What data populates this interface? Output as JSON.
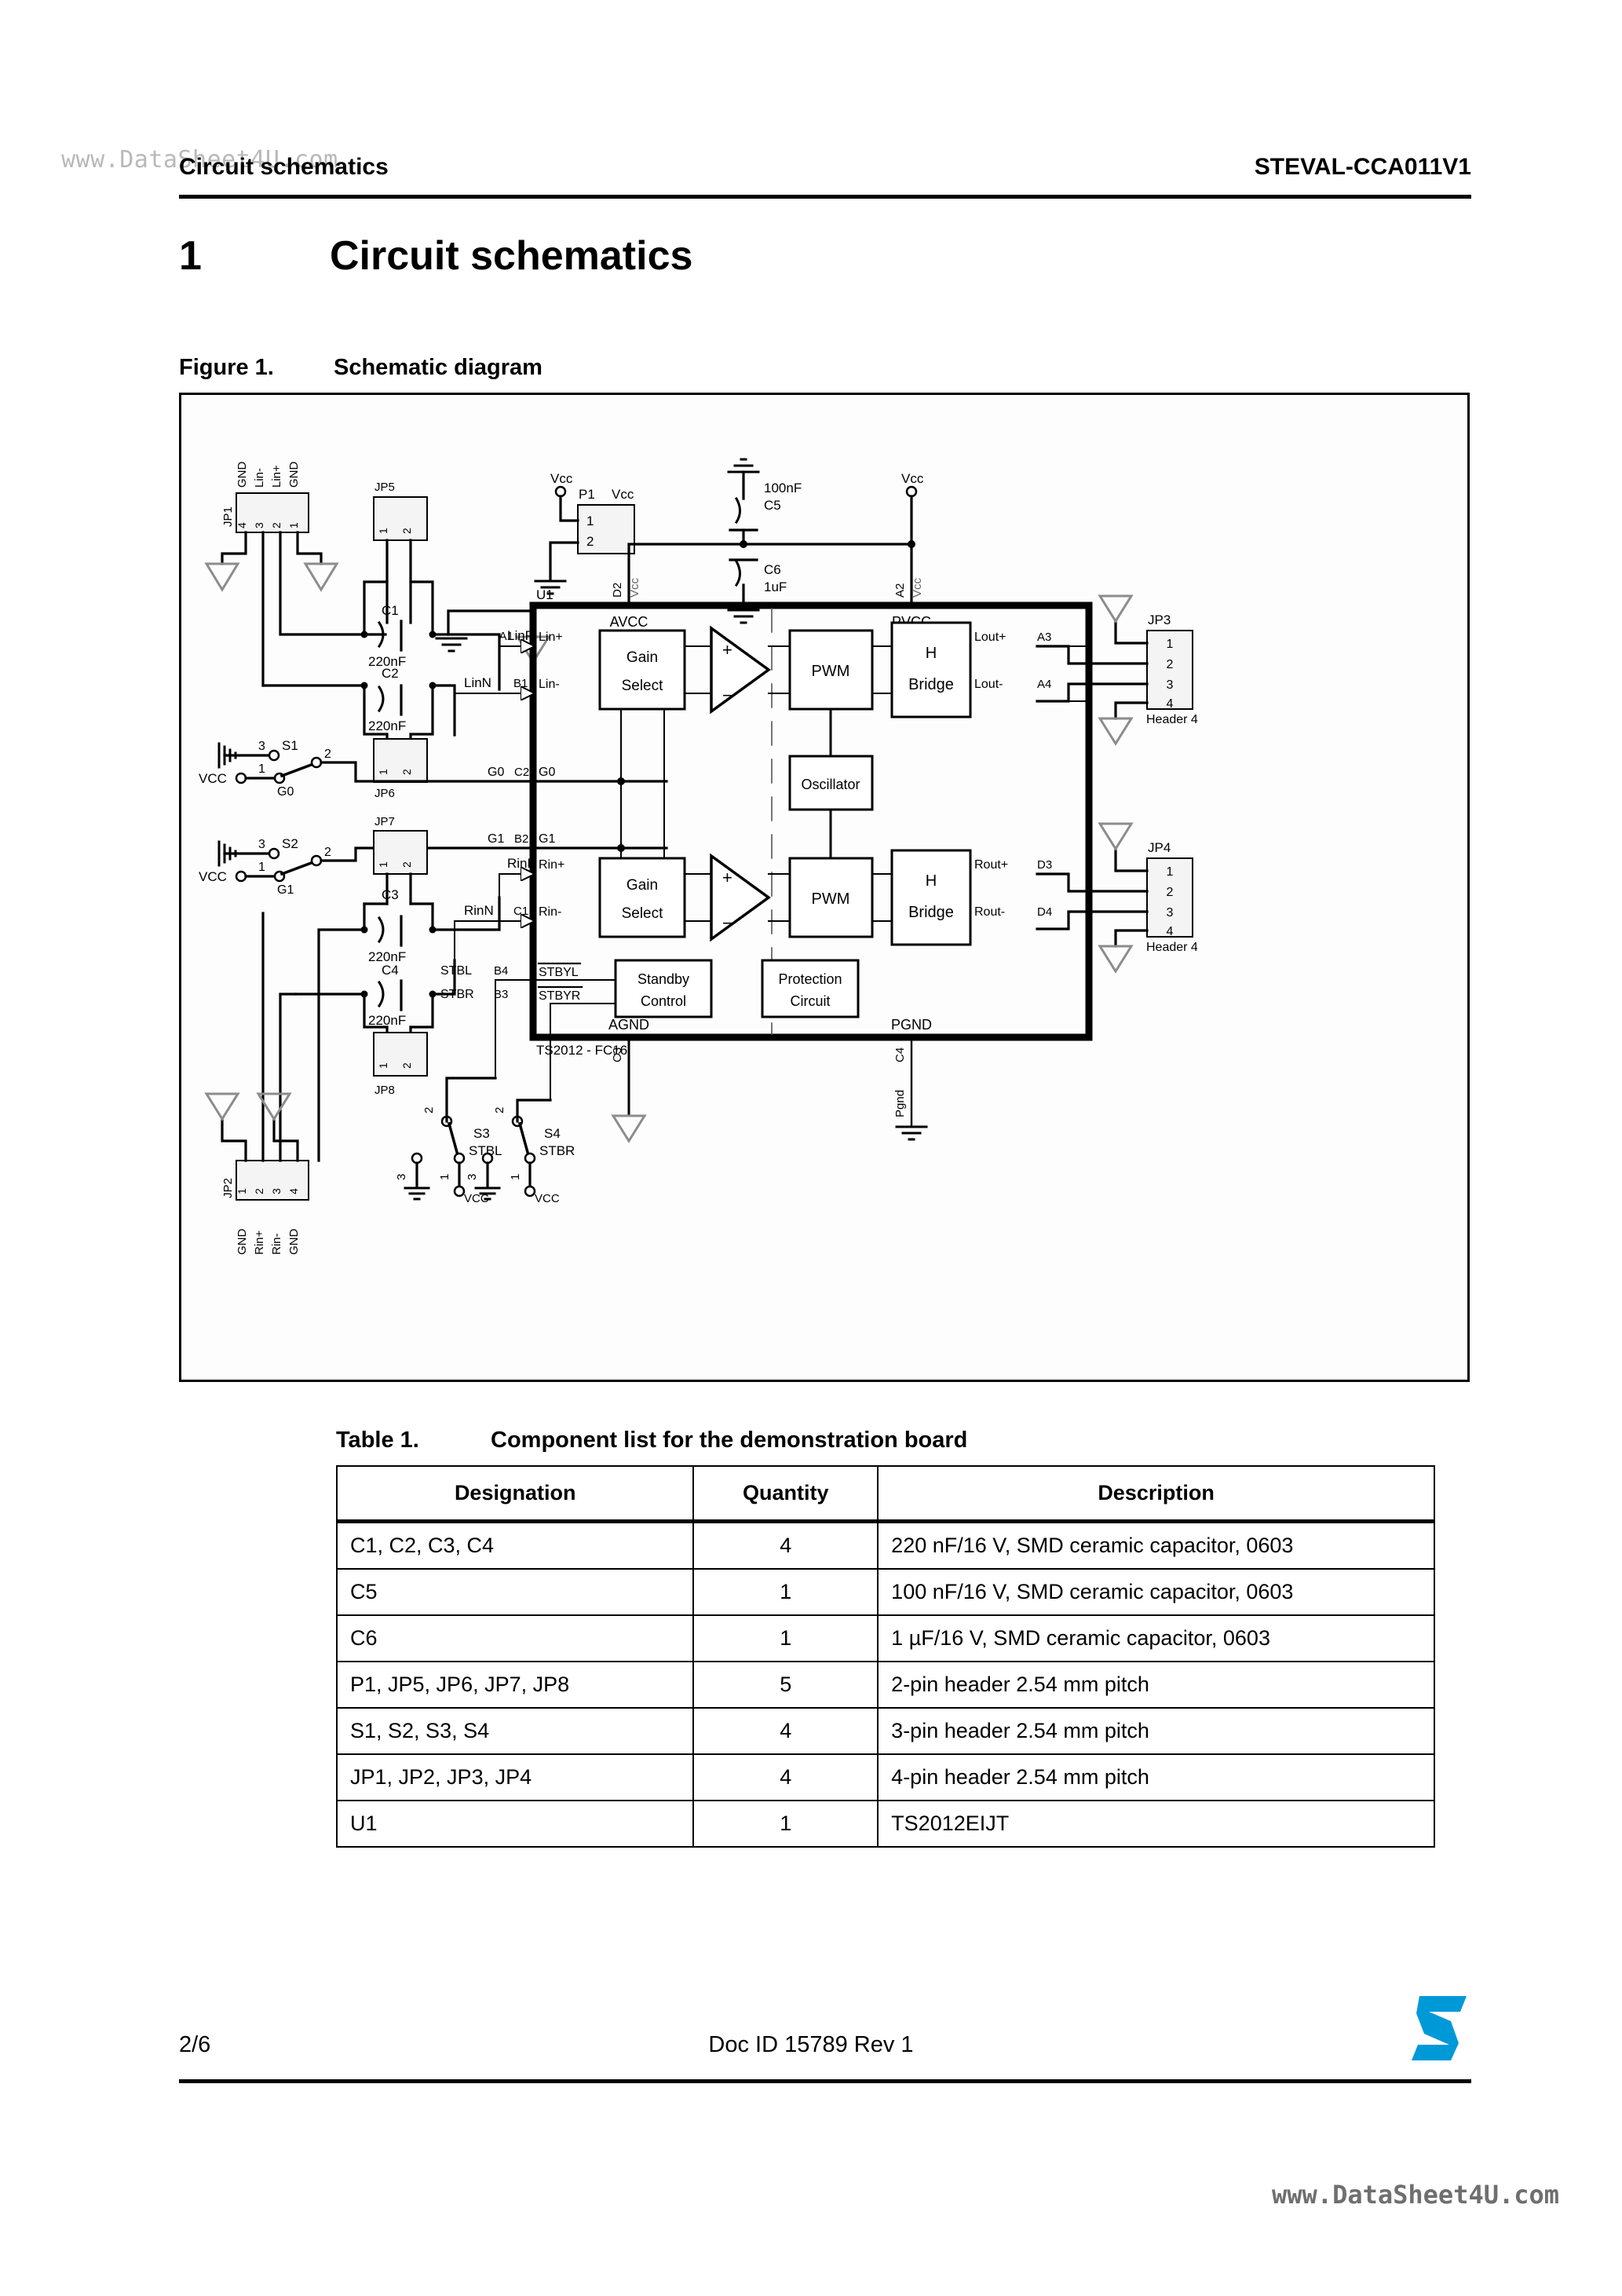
{
  "watermark": {
    "top": "www.DataSheet4U.com",
    "bottom": "www.DataSheet4U.com"
  },
  "header": {
    "left": "Circuit schematics",
    "right": "STEVAL-CCA011V1"
  },
  "section": {
    "number": "1",
    "title": "Circuit schematics"
  },
  "figure": {
    "label": "Figure 1.",
    "caption": "Schematic diagram",
    "schematic": {
      "ic": {
        "refdes": "U1",
        "part": "TS2012 - FC16",
        "rails": {
          "avcc": "AVCC",
          "pvcc": "PVCC",
          "agnd": "AGND",
          "pgnd": "PGND"
        },
        "blocks": [
          "Gain Select",
          "PWM",
          "H Bridge",
          "Oscillator",
          "Gain Select",
          "PWM",
          "H Bridge",
          "Standby Control",
          "Protection Circuit"
        ],
        "block_labels": {
          "gain": "Gain",
          "select": "Select",
          "pwm": "PWM",
          "h": "H",
          "bridge": "Bridge",
          "oscillator": "Oscillator",
          "standby": "Standby",
          "control": "Control",
          "protection": "Protection",
          "circuit": "Circuit"
        },
        "pins": [
          {
            "pin": "A1",
            "name": "Lin+",
            "net": "LinP"
          },
          {
            "pin": "B1",
            "name": "Lin-",
            "net": "LinN"
          },
          {
            "pin": "C2",
            "name": "G0",
            "net": "G0"
          },
          {
            "pin": "B2",
            "name": "G1",
            "net": "G1"
          },
          {
            "pin": "D1",
            "name": "Rin+",
            "net": "RinP"
          },
          {
            "pin": "C1",
            "name": "Rin-",
            "net": "RinN"
          },
          {
            "pin": "B4",
            "name": "STBYL",
            "net": "STBL"
          },
          {
            "pin": "B3",
            "name": "STBYR",
            "net": "STBR"
          },
          {
            "pin": "A3",
            "name": "Lout+",
            "net": ""
          },
          {
            "pin": "A4",
            "name": "Lout-",
            "net": ""
          },
          {
            "pin": "D3",
            "name": "Rout+",
            "net": ""
          },
          {
            "pin": "D4",
            "name": "Rout-",
            "net": ""
          },
          {
            "pin": "D2",
            "name": "Vcc",
            "net": "AVCC"
          },
          {
            "pin": "A2",
            "name": "Vcc",
            "net": "PVCC"
          },
          {
            "pin": "C3",
            "name": "",
            "net": "AGND"
          },
          {
            "pin": "C4",
            "name": "Pgnd",
            "net": "PGND"
          }
        ],
        "opamp_plus": "+",
        "opamp_minus": "−"
      },
      "connectors": [
        {
          "ref": "JP1",
          "pins": [
            "4",
            "3",
            "2",
            "1"
          ],
          "labels": [
            "GND",
            "Lin-",
            "Lin+",
            "GND"
          ]
        },
        {
          "ref": "JP2",
          "pins": [
            "1",
            "2",
            "3",
            "4"
          ],
          "labels": [
            "GND",
            "Rin+",
            "Rin-",
            "GND"
          ]
        },
        {
          "ref": "JP3",
          "pins": [
            "1",
            "2",
            "3",
            "4"
          ],
          "type": "Header 4"
        },
        {
          "ref": "JP4",
          "pins": [
            "1",
            "2",
            "3",
            "4"
          ],
          "type": "Header 4"
        },
        {
          "ref": "JP5",
          "pins": [
            "1",
            "2"
          ]
        },
        {
          "ref": "JP6",
          "pins": [
            "1",
            "2"
          ]
        },
        {
          "ref": "JP7",
          "pins": [
            "1",
            "2"
          ]
        },
        {
          "ref": "JP8",
          "pins": [
            "1",
            "2"
          ]
        },
        {
          "ref": "P1",
          "pins": [
            "1",
            "2"
          ],
          "rail": "Vcc"
        }
      ],
      "capacitors": [
        {
          "ref": "C1",
          "value": "220nF"
        },
        {
          "ref": "C2",
          "value": "220nF"
        },
        {
          "ref": "C3",
          "value": "220nF"
        },
        {
          "ref": "C4",
          "value": "220nF"
        },
        {
          "ref": "C5",
          "value": "100nF"
        },
        {
          "ref": "C6",
          "value": "1uF"
        }
      ],
      "switches": [
        {
          "ref": "S1",
          "sig": "G0",
          "pins": [
            "1",
            "2",
            "3"
          ],
          "src": "VCC"
        },
        {
          "ref": "S2",
          "sig": "G1",
          "pins": [
            "1",
            "2",
            "3"
          ],
          "src": "VCC"
        },
        {
          "ref": "S3",
          "sig": "STBL",
          "pins": [
            "1",
            "2",
            "3"
          ],
          "src": "VCC"
        },
        {
          "ref": "S4",
          "sig": "STBR",
          "pins": [
            "1",
            "2",
            "3"
          ],
          "src": "VCC"
        }
      ],
      "nets": [
        "Vcc",
        "VCC",
        "LinP",
        "LinN",
        "RinP",
        "RinN",
        "G0",
        "G1",
        "STBL",
        "STBR",
        "Pgnd"
      ]
    }
  },
  "table": {
    "label": "Table 1.",
    "caption": "Component list for the demonstration board",
    "columns": [
      "Designation",
      "Quantity",
      "Description"
    ],
    "rows": [
      {
        "designation": "C1, C2, C3, C4",
        "quantity": "4",
        "description": "220 nF/16 V, SMD ceramic capacitor, 0603"
      },
      {
        "designation": "C5",
        "quantity": "1",
        "description": "100 nF/16 V, SMD ceramic capacitor, 0603"
      },
      {
        "designation": "C6",
        "quantity": "1",
        "description": "1 µF/16 V, SMD ceramic capacitor, 0603"
      },
      {
        "designation": "P1, JP5, JP6, JP7, JP8",
        "quantity": "5",
        "description": "2-pin header 2.54 mm pitch"
      },
      {
        "designation": "S1, S2, S3, S4",
        "quantity": "4",
        "description": "3-pin header 2.54 mm pitch"
      },
      {
        "designation": "JP1, JP2, JP3, JP4",
        "quantity": "4",
        "description": "4-pin header 2.54 mm pitch"
      },
      {
        "designation": "U1",
        "quantity": "1",
        "description": "TS2012EIJT"
      }
    ]
  },
  "footer": {
    "page": "2/6",
    "doc": "Doc ID 15789 Rev 1",
    "logo": "st-logo"
  },
  "colors": {
    "logo_blue": "#0099d8",
    "gnd_gray": "#8c8c8c",
    "text": "#000000"
  }
}
